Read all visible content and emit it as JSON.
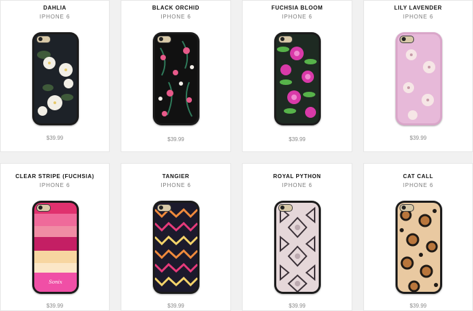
{
  "products": [
    {
      "name": "DAHLIA",
      "model": "IPHONE 6",
      "price": "$39.99",
      "pattern": "white-flowers-on-black",
      "colors": {
        "bg": "#1d2228",
        "accent": "#f2efe6",
        "leaf": "#3f5a3a"
      }
    },
    {
      "name": "BLACK ORCHID",
      "model": "IPHONE 6",
      "price": "$39.99",
      "pattern": "pink-orchids-on-black",
      "colors": {
        "bg": "#111111",
        "accent": "#e85a8a",
        "leaf": "#2f7a5a"
      }
    },
    {
      "name": "FUCHSIA BLOOM",
      "model": "IPHONE 6",
      "price": "$39.99",
      "pattern": "fuchsia-roses-green-leaves",
      "colors": {
        "bg": "#1e2a22",
        "accent": "#d83aa8",
        "leaf": "#57b34a"
      }
    },
    {
      "name": "LILY LAVENDER",
      "model": "IPHONE 6",
      "price": "$39.99",
      "pattern": "lilies-on-lavender",
      "colors": {
        "bg": "#e7b9d9",
        "accent": "#f6e6e6",
        "leaf": "#c79aa8"
      }
    },
    {
      "name": "CLEAR STRIPE (FUCHSIA)",
      "model": "IPHONE 6",
      "price": "$39.99",
      "pattern": "pink-gold-stripes",
      "colors": {
        "bg": "#e0316e",
        "accent": "#f7d6a0",
        "leaf": "#ef6a9a"
      }
    },
    {
      "name": "TANGIER",
      "model": "IPHONE 6",
      "price": "$39.99",
      "pattern": "tribal-zigzag",
      "colors": {
        "bg": "#1c1a2c",
        "accent": "#f08a3c",
        "leaf": "#e63a7a"
      }
    },
    {
      "name": "ROYAL PYTHON",
      "model": "IPHONE 6",
      "price": "$39.99",
      "pattern": "snakeskin",
      "colors": {
        "bg": "#e5d7d9",
        "accent": "#3a3037",
        "leaf": "#bcaab0"
      }
    },
    {
      "name": "CAT CALL",
      "model": "IPHONE 6",
      "price": "$39.99",
      "pattern": "leopard",
      "colors": {
        "bg": "#e9c9a1",
        "accent": "#1f1a16",
        "leaf": "#b9763c"
      }
    }
  ]
}
